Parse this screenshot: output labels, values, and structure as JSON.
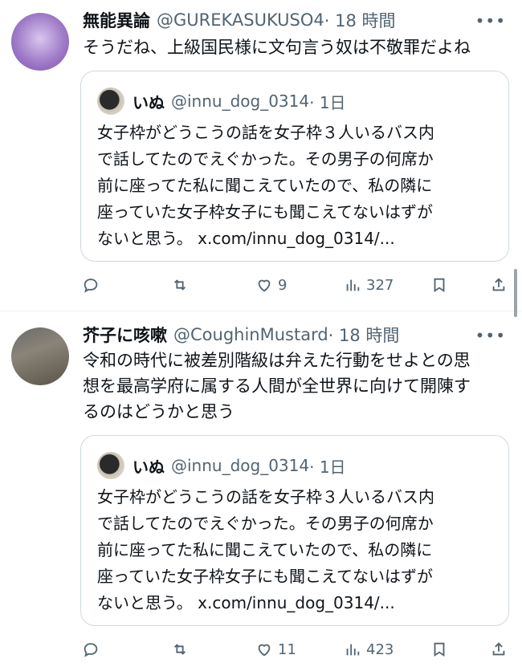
{
  "tweets": [
    {
      "author": "無能異論",
      "handle": "@GUREKASUKUSO4",
      "time": "· 18 時間",
      "text": "そうだね、上級国民様に文句言う奴は不敬罪だよね",
      "quote": {
        "author": "いぬ",
        "handle": "@innu_dog_0314",
        "time": "· 1日",
        "text": "女子枠がどうこうの話を女子枠３人いるバス内\nで話してたのでえぐかった。その男子の何席か\n前に座ってた私に聞こえていたので、私の隣に\n座っていた女子枠女子にも聞こえてないはずが\nないと思う。 x.com/innu_dog_0314/..."
      },
      "likes": "9",
      "views": "327"
    },
    {
      "author": "芥子に咳嗽",
      "handle": "@CoughinMustard",
      "time": "· 18 時間",
      "text": "令和の時代に被差別階級は弁えた行動をせよとの思\n想を最高学府に属する人間が全世界に向けて開陳す\nるのはどうかと思う",
      "quote": {
        "author": "いぬ",
        "handle": "@innu_dog_0314",
        "time": "· 1日",
        "text": "女子枠がどうこうの話を女子枠３人いるバス内\nで話してたのでえぐかった。その男子の何席か\n前に座ってた私に聞こえていたので、私の隣に\n座っていた女子枠女子にも聞こえてないはずが\nないと思う。 x.com/innu_dog_0314/..."
      },
      "likes": "11",
      "views": "423"
    }
  ],
  "more_label": "•••",
  "icons": {
    "reply": "reply-icon",
    "retweet": "retweet-icon",
    "like": "heart-icon",
    "views": "views-icon",
    "bookmark": "bookmark-icon",
    "share": "share-icon"
  },
  "colors": {
    "text": "#0f1419",
    "secondary": "#536471",
    "border": "#cfd9de"
  }
}
